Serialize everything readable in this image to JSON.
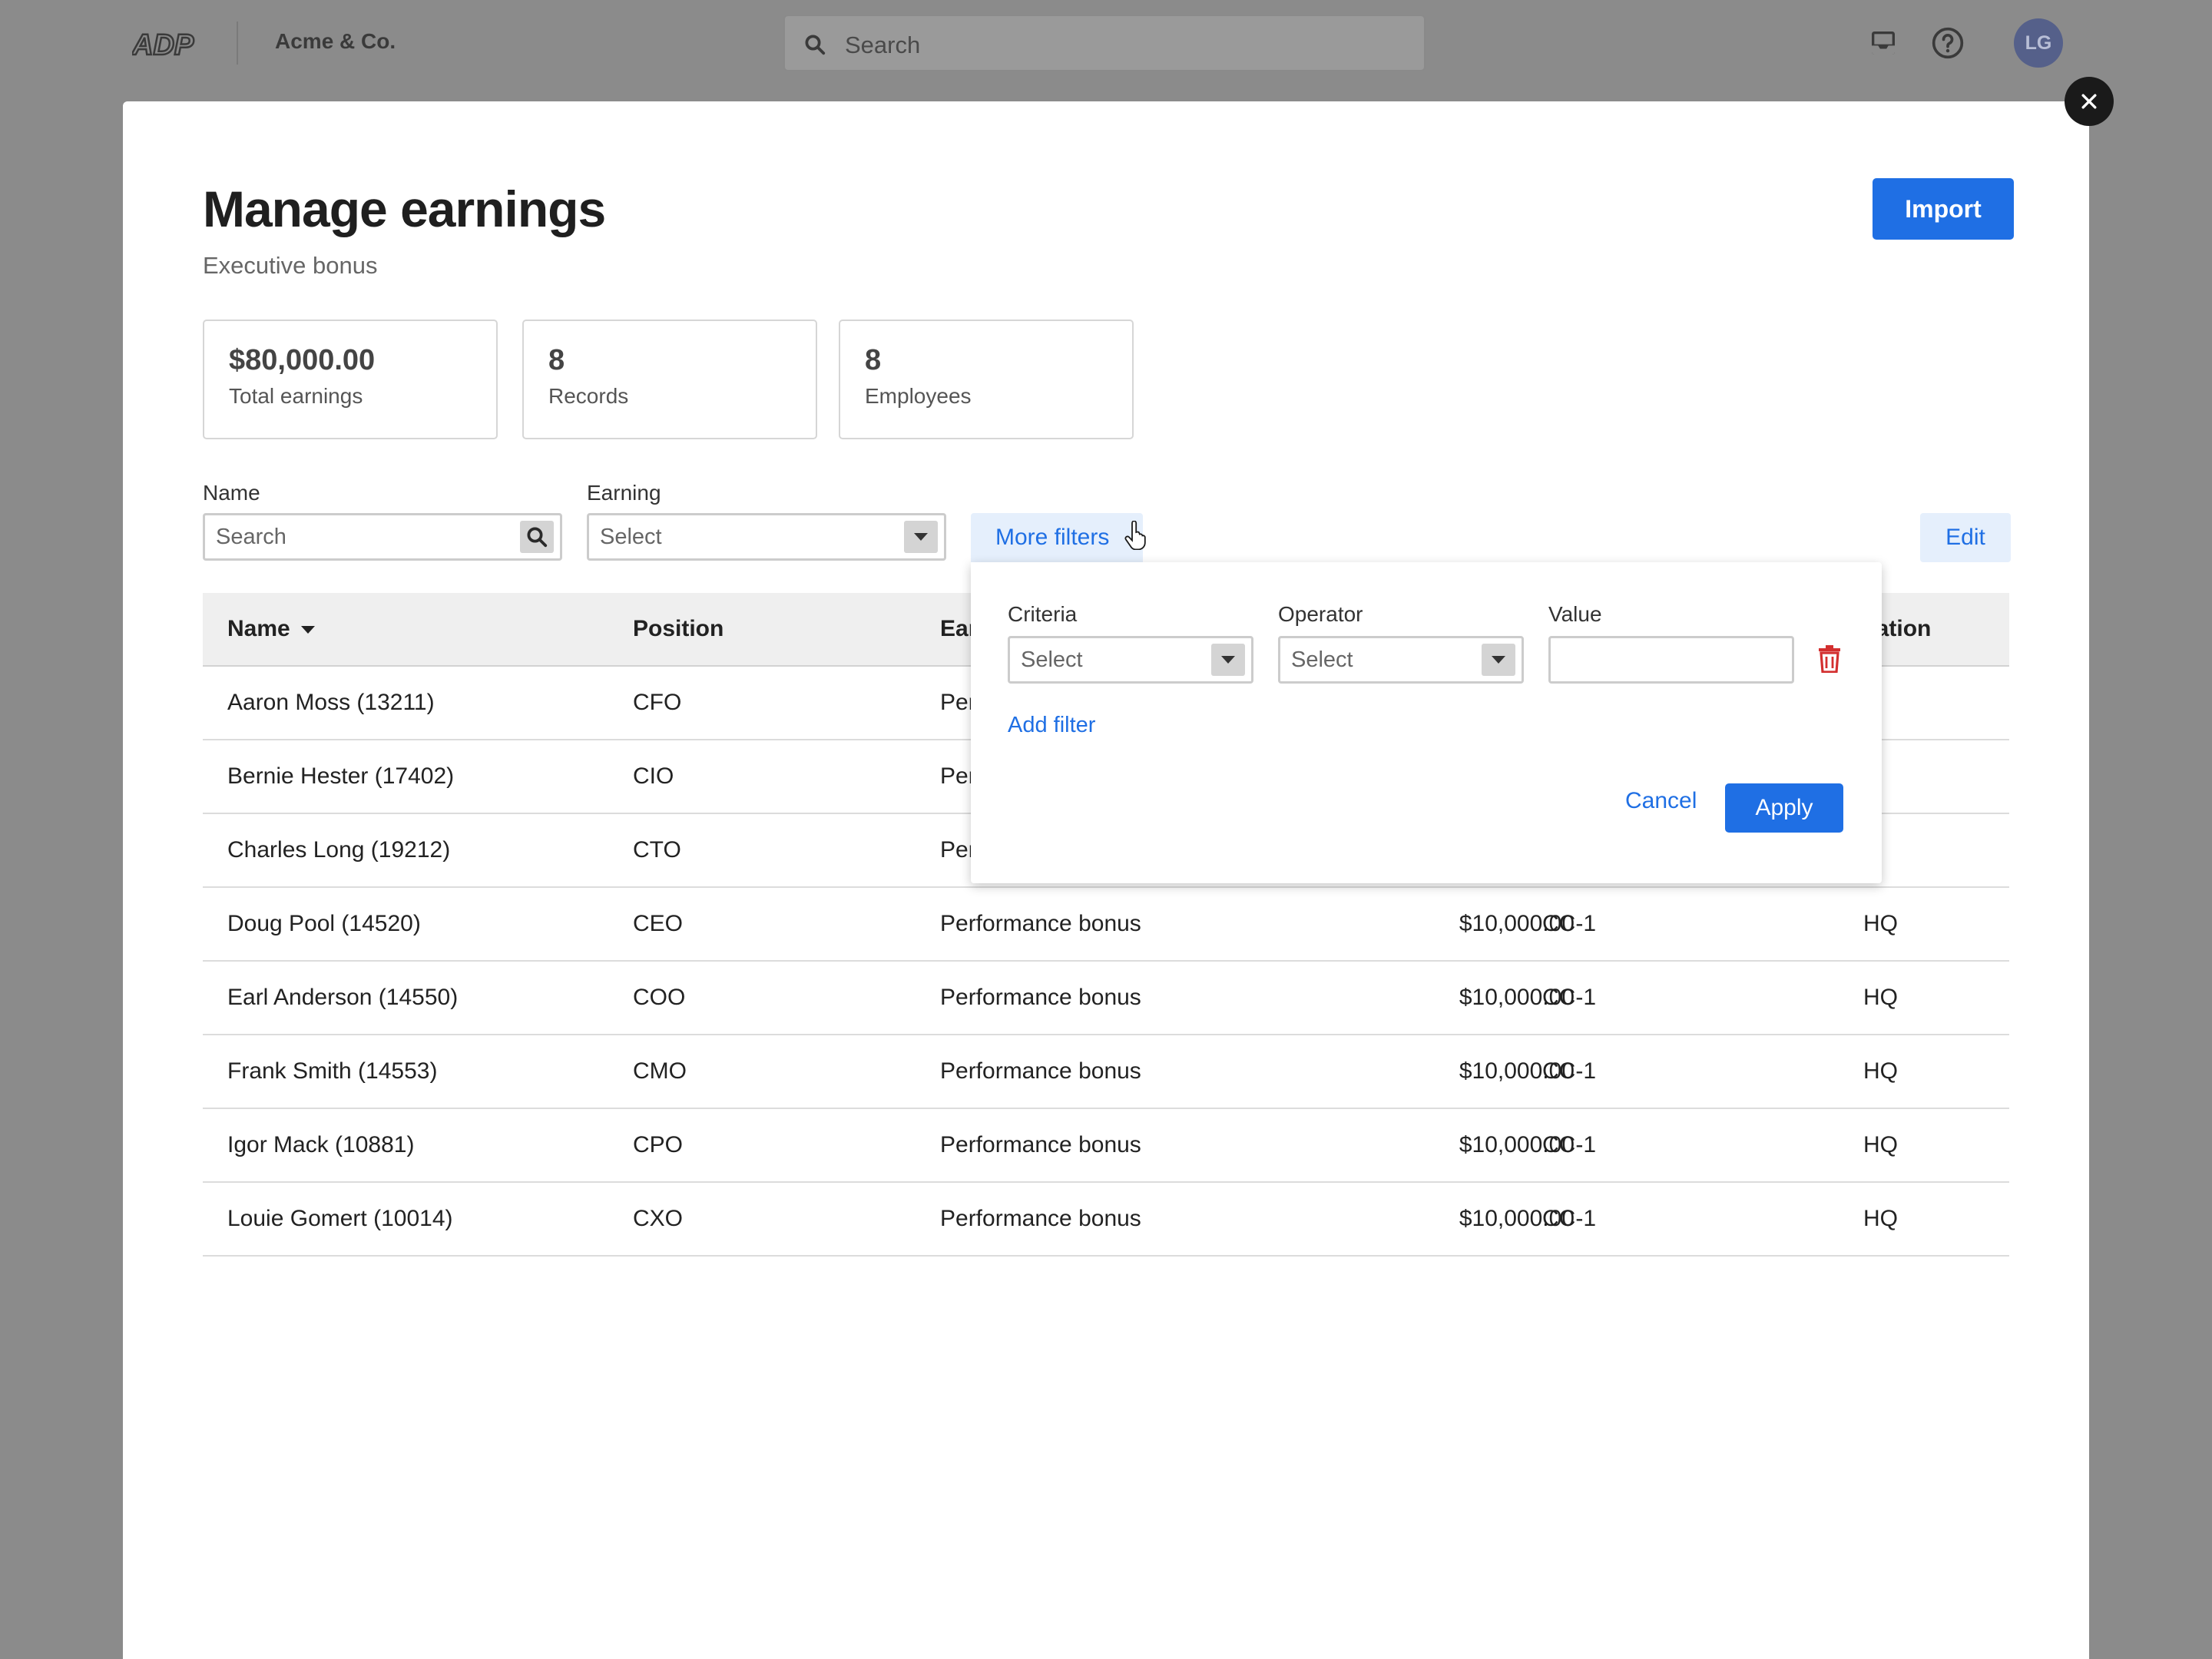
{
  "topbar": {
    "logo_text": "ADP",
    "company": "Acme & Co.",
    "search_placeholder": "Search",
    "avatar_initials": "LG"
  },
  "modal": {
    "title": "Manage earnings",
    "subtitle": "Executive bonus",
    "import_label": "Import",
    "stats": [
      {
        "value": "$80,000.00",
        "label": "Total earnings"
      },
      {
        "value": "8",
        "label": "Records"
      },
      {
        "value": "8",
        "label": "Employees"
      }
    ],
    "filters": {
      "name_label": "Name",
      "name_placeholder": "Search",
      "earning_label": "Earning",
      "earning_placeholder": "Select",
      "more_filters_label": "More filters",
      "edit_label": "Edit"
    },
    "popover": {
      "criteria_label": "Criteria",
      "criteria_placeholder": "Select",
      "operator_label": "Operator",
      "operator_placeholder": "Select",
      "value_label": "Value",
      "value": "",
      "add_filter_label": "Add filter",
      "cancel_label": "Cancel",
      "apply_label": "Apply"
    },
    "table": {
      "columns": [
        "Name",
        "Position",
        "Ear",
        "",
        "",
        "cation"
      ],
      "rows": [
        {
          "name": "Aaron Moss (13211)",
          "position": "CFO",
          "earning": "Per",
          "amount": "",
          "cost_center": "",
          "location": ""
        },
        {
          "name": "Bernie Hester (17402)",
          "position": "CIO",
          "earning": "Per",
          "amount": "",
          "cost_center": "",
          "location": ""
        },
        {
          "name": "Charles Long (19212)",
          "position": "CTO",
          "earning": "Per",
          "amount": "",
          "cost_center": "",
          "location": ""
        },
        {
          "name": "Doug Pool (14520)",
          "position": "CEO",
          "earning": "Performance bonus",
          "amount": "$10,000.00",
          "cost_center": "CC-1",
          "location": "HQ"
        },
        {
          "name": "Earl Anderson (14550)",
          "position": "COO",
          "earning": "Performance bonus",
          "amount": "$10,000.00",
          "cost_center": "CC-1",
          "location": "HQ"
        },
        {
          "name": "Frank Smith (14553)",
          "position": "CMO",
          "earning": "Performance bonus",
          "amount": "$10,000.00",
          "cost_center": "CC-1",
          "location": "HQ"
        },
        {
          "name": "Igor Mack (10881)",
          "position": "CPO",
          "earning": "Performance bonus",
          "amount": "$10,000.00",
          "cost_center": "CC-1",
          "location": "HQ"
        },
        {
          "name": "Louie Gomert (10014)",
          "position": "CXO",
          "earning": "Performance bonus",
          "amount": "$10,000.00",
          "cost_center": "CC-1",
          "location": "HQ"
        }
      ]
    }
  },
  "colors": {
    "accent": "#1f6fe4",
    "danger": "#d32f2f",
    "backdrop": "#8b8b8b"
  },
  "icons": [
    "search-icon",
    "inbox-icon",
    "help-icon",
    "close-icon",
    "chevron-down-icon",
    "trash-icon",
    "pointer-cursor-icon"
  ]
}
